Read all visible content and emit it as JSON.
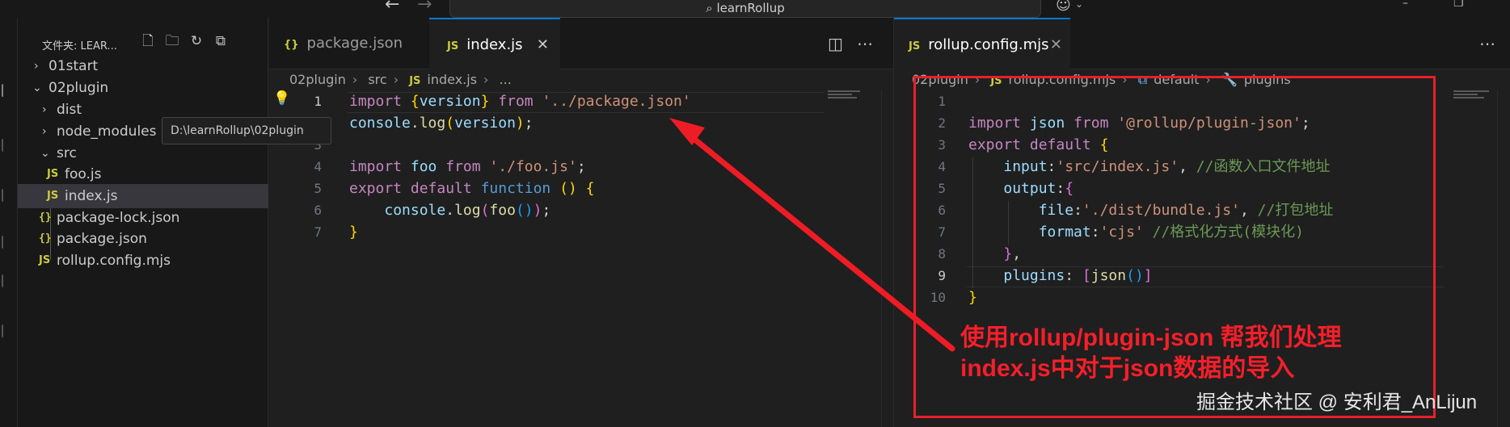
{
  "titlebar": {
    "search_text": "learnRollup",
    "back_icon": "arrow-left-icon",
    "forward_icon": "arrow-right-icon",
    "search_icon": "search-icon",
    "copilot_icon": "copilot-icon"
  },
  "explorer": {
    "title": "文件夹: LEAR...",
    "actions": [
      "new-file-icon",
      "new-folder-icon",
      "refresh-icon",
      "collapse-all-icon"
    ],
    "items": [
      {
        "label": "01start",
        "type": "folder",
        "expanded": false
      },
      {
        "label": "02plugin",
        "type": "folder",
        "expanded": true
      },
      {
        "label": "dist",
        "type": "folder",
        "expanded": false
      },
      {
        "label": "node_modules",
        "type": "folder",
        "expanded": false
      },
      {
        "label": "src",
        "type": "folder",
        "expanded": true
      },
      {
        "label": "foo.js",
        "type": "js"
      },
      {
        "label": "index.js",
        "type": "js",
        "selected": true
      },
      {
        "label": "package-lock.json",
        "type": "json"
      },
      {
        "label": "package.json",
        "type": "json"
      },
      {
        "label": "rollup.config.mjs",
        "type": "js"
      }
    ],
    "tooltip": "D:\\learnRollup\\02plugin",
    "js_badge": "JS",
    "json_badge": "{}"
  },
  "left_editor": {
    "tabs": [
      {
        "label": "package.json",
        "badge": "{}"
      },
      {
        "label": "index.js",
        "badge": "JS",
        "active": true
      }
    ],
    "breadcrumb": [
      "02plugin",
      "src",
      "JS",
      "index.js",
      "..."
    ],
    "current_line": 1,
    "line_numbers": [
      "1",
      "2",
      "3",
      "4",
      "5",
      "6",
      "7"
    ],
    "lines": [
      "import {version} from '../package.json'",
      "console.log(version);",
      "",
      "import foo from './foo.js';",
      "export default function () {",
      "    console.log(foo());",
      "}"
    ]
  },
  "right_editor": {
    "tabs": [
      {
        "label": "rollup.config.mjs",
        "badge": "JS",
        "active": true
      }
    ],
    "breadcrumb": [
      "02plugin",
      "JS",
      "rollup.config.mjs",
      "default",
      "plugins"
    ],
    "current_line": 9,
    "line_numbers": [
      "1",
      "2",
      "3",
      "4",
      "5",
      "6",
      "7",
      "8",
      "9",
      "10"
    ],
    "lines": [
      "",
      "import json from '@rollup/plugin-json';",
      "export default {",
      "    input:'src/index.js', //函数入口文件地址",
      "    output:{",
      "        file:'./dist/bundle.js', //打包地址",
      "        format:'cjs' //格式化方式(模块化)",
      "    },",
      "    plugins: [json()]",
      "}"
    ]
  },
  "annotation": {
    "line1": "使用rollup/plugin-json 帮我们处理",
    "line2": "index.js中对于json数据的导入",
    "color": "#f41f2a"
  },
  "watermark": "掘金技术社区 @ 安利君_AnLijun"
}
